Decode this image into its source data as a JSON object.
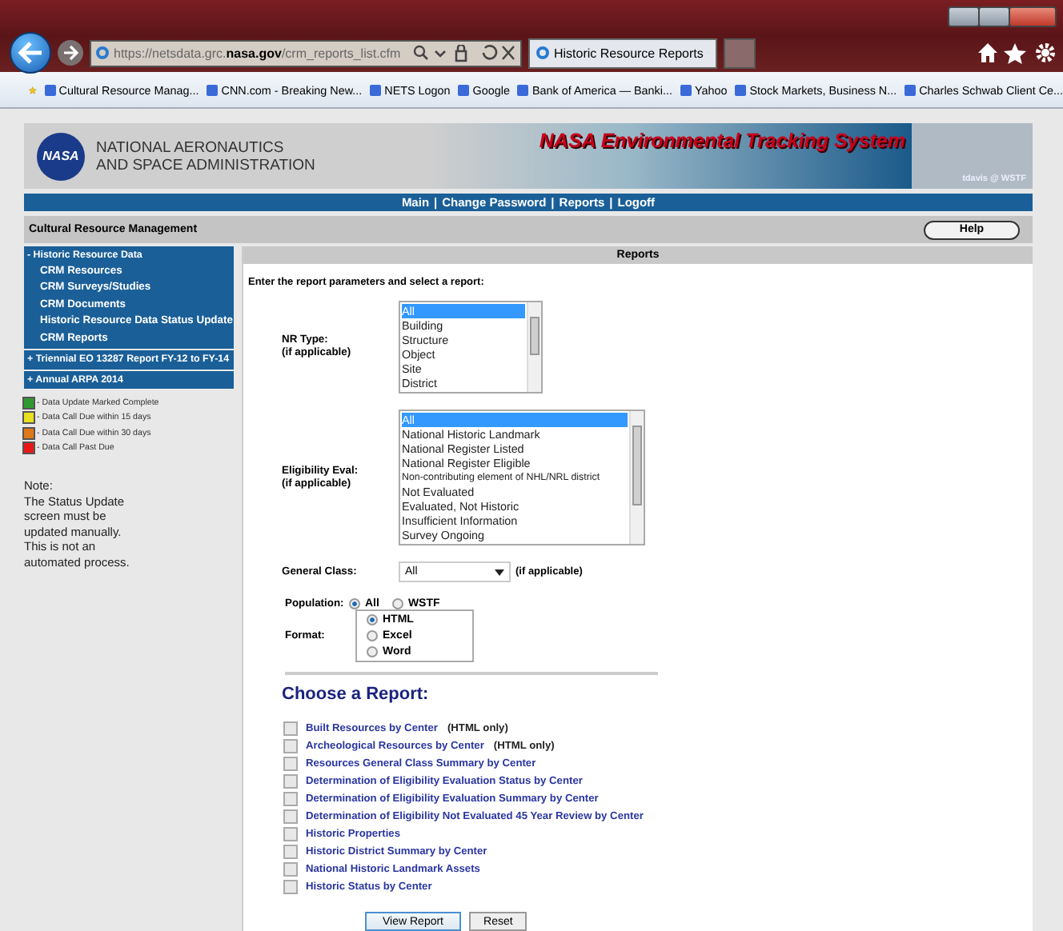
{
  "browser": {
    "url": "https://netsdata.grc.**nasa.gov**/crm_reports_list.cfm",
    "tab_title": "Historic Resource Reports",
    "favorites": [
      "Cultural Resource Manag...",
      "CNN.com - Breaking New...",
      "NETS Logon",
      "Google",
      "Bank of America — Banki...",
      "Yahoo",
      "Stock Markets, Business N...",
      "Charles Schwab Client Ce..."
    ]
  },
  "header": {
    "org_lines": [
      "NATIONAL AERONAUTICS",
      "AND SPACE ADMINISTRATION"
    ],
    "logo_text": "NASA",
    "system_title": "NASA Environmental Tracking System",
    "user": "tdavis @ WSTF"
  },
  "nav": {
    "separator": "|",
    "links": [
      "Main",
      "Change Password",
      "Reports",
      "Logoff"
    ]
  },
  "section_bar": {
    "title": "Cultural Resource Management",
    "help_button": "Help"
  },
  "sidebar": {
    "groups": [
      {
        "marker": "-",
        "label": "Historic Resource Data",
        "expanded": true,
        "items": [
          "CRM Resources",
          "CRM Surveys/Studies",
          "CRM Documents",
          "Historic Resource Data Status Update",
          "CRM Reports"
        ]
      },
      {
        "marker": "+",
        "label": "Triennial EO 13287 Report FY-12 to FY-14",
        "expanded": false
      },
      {
        "marker": "+",
        "label": "Annual ARPA 2014",
        "expanded": false
      }
    ],
    "legend": [
      {
        "label": "- Data Update Marked Complete",
        "color": "#2e9a2e"
      },
      {
        "label": "- Data Call Due within 15 days",
        "color": "#e8e020"
      },
      {
        "label": "- Data Call Due within 30 days",
        "color": "#e07818"
      },
      {
        "label": "- Data Call Past Due",
        "color": "#e81818"
      }
    ],
    "note": [
      "Note:",
      "The Status Update",
      "screen must be",
      "updated manually.",
      "This is not an",
      "automated process."
    ]
  },
  "reports_panel": {
    "title": "Reports",
    "instructions": "Enter the report parameters and select a report:",
    "nr_type": {
      "label": [
        "NR Type:",
        "(if applicable)"
      ],
      "options": [
        {
          "label": "All",
          "selected": true
        },
        {
          "label": "Building",
          "selected": false
        },
        {
          "label": "Structure",
          "selected": false
        },
        {
          "label": "Object",
          "selected": false
        },
        {
          "label": "Site",
          "selected": false
        },
        {
          "label": "District",
          "selected": false
        }
      ]
    },
    "eligibility": {
      "label": [
        "Eligibility Eval:",
        "(if applicable)"
      ],
      "options": [
        {
          "label": "All",
          "selected": true
        },
        {
          "label": "National Historic Landmark",
          "selected": false
        },
        {
          "label": "National Register Listed",
          "selected": false
        },
        {
          "label": "National Register Eligible",
          "selected": false
        },
        {
          "label": "Non-contributing element of NHL/NRL district",
          "selected": false
        },
        {
          "label": "Not Evaluated",
          "selected": false
        },
        {
          "label": "Evaluated, Not Historic",
          "selected": false
        },
        {
          "label": "Insufficient Information",
          "selected": false
        },
        {
          "label": "Survey Ongoing",
          "selected": false
        }
      ]
    },
    "general_class": {
      "label": "General Class:",
      "value": "All",
      "note": "(if applicable)"
    },
    "population": {
      "label": "Population:",
      "options": [
        {
          "label": "All",
          "selected": true
        },
        {
          "label": "WSTF",
          "selected": false
        }
      ]
    },
    "format": {
      "label": "Format:",
      "options": [
        {
          "label": "HTML",
          "selected": true
        },
        {
          "label": "Excel",
          "selected": false
        },
        {
          "label": "Word",
          "selected": false
        }
      ]
    },
    "heading": "Choose a Report:",
    "reports": [
      {
        "label": "Built Resources by Center",
        "note": "(HTML only)",
        "checked": false
      },
      {
        "label": "Archeological Resources by Center",
        "note": "(HTML only)",
        "checked": false
      },
      {
        "label": "Resources General Class Summary by Center",
        "checked": false
      },
      {
        "label": "Determination of Eligibility Evaluation Status by Center",
        "checked": false
      },
      {
        "label": "Determination of Eligibility Evaluation Summary by Center",
        "checked": false
      },
      {
        "label": "Determination of Eligibility Not Evaluated 45 Year Review by Center",
        "checked": false
      },
      {
        "label": "Historic Properties",
        "checked": false
      },
      {
        "label": "Historic District Summary by Center",
        "checked": false
      },
      {
        "label": "National Historic Landmark Assets",
        "checked": false
      },
      {
        "label": "Historic Status by Center",
        "checked": false
      }
    ],
    "buttons": [
      "View Report",
      "Reset"
    ]
  }
}
